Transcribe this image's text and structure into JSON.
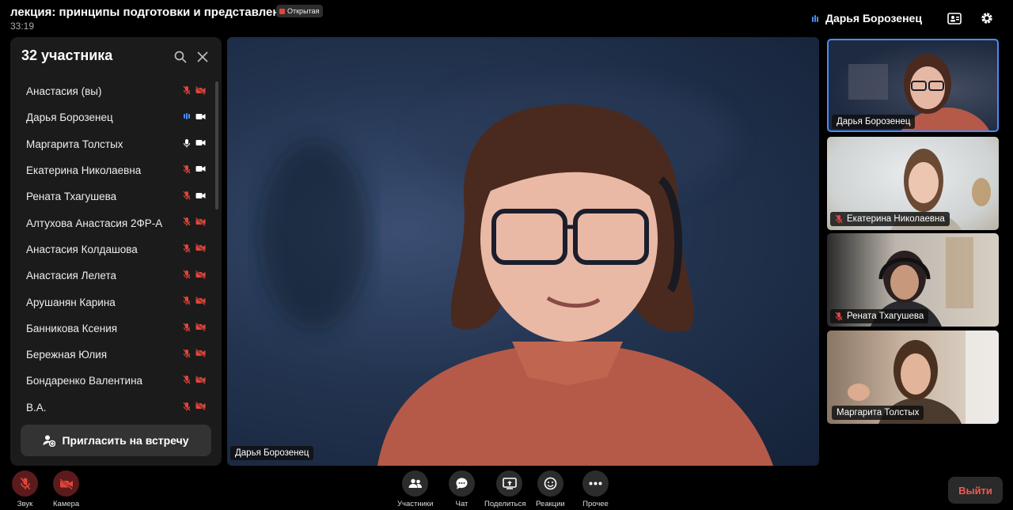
{
  "header": {
    "title": "лекция: принципы подготовки и представлени...",
    "badge": "Открытая",
    "timer": "33:19",
    "active_speaker": "Дарья Борозенец"
  },
  "panel": {
    "title": "32 участника",
    "invite_label": "Пригласить на встречу",
    "participants": [
      {
        "name": "Анастасия (вы)",
        "mic": "muted",
        "cam": "off"
      },
      {
        "name": "Дарья Борозенец",
        "mic": "speaking",
        "cam": "on"
      },
      {
        "name": "Маргарита Толстых",
        "mic": "on",
        "cam": "on"
      },
      {
        "name": "Екатерина Николаевна",
        "mic": "muted",
        "cam": "on"
      },
      {
        "name": "Рената Тхагушева",
        "mic": "muted",
        "cam": "on"
      },
      {
        "name": "Алтухова Анастасия 2ФР-А",
        "mic": "muted",
        "cam": "off"
      },
      {
        "name": "Анастасия Колдашова",
        "mic": "muted",
        "cam": "off"
      },
      {
        "name": "Анастасия Лелета",
        "mic": "muted",
        "cam": "off"
      },
      {
        "name": "Арушанян Карина",
        "mic": "muted",
        "cam": "off"
      },
      {
        "name": "Банникова Ксения",
        "mic": "muted",
        "cam": "off"
      },
      {
        "name": "Бережная Юлия",
        "mic": "muted",
        "cam": "off"
      },
      {
        "name": "Бондаренко Валентина",
        "mic": "muted",
        "cam": "off"
      },
      {
        "name": "В.А.",
        "mic": "muted",
        "cam": "off"
      }
    ]
  },
  "main_video": {
    "name": "Дарья Борозенец"
  },
  "tiles": [
    {
      "name": "Дарья Борозенец",
      "muted": false
    },
    {
      "name": "Екатерина Николаевна",
      "muted": true
    },
    {
      "name": "Рената Тхагушева",
      "muted": true
    },
    {
      "name": "Маргарита Толстых",
      "muted": false
    }
  ],
  "controls": {
    "sound": "Звук",
    "camera": "Камера",
    "participants": "Участники",
    "chat": "Чат",
    "share": "Поделиться",
    "reactions": "Реакции",
    "more": "Прочее",
    "exit": "Выйти"
  },
  "colors": {
    "accent": "#4a8cf7",
    "muted_red": "#e2453c",
    "exit_red": "#f05a52"
  }
}
